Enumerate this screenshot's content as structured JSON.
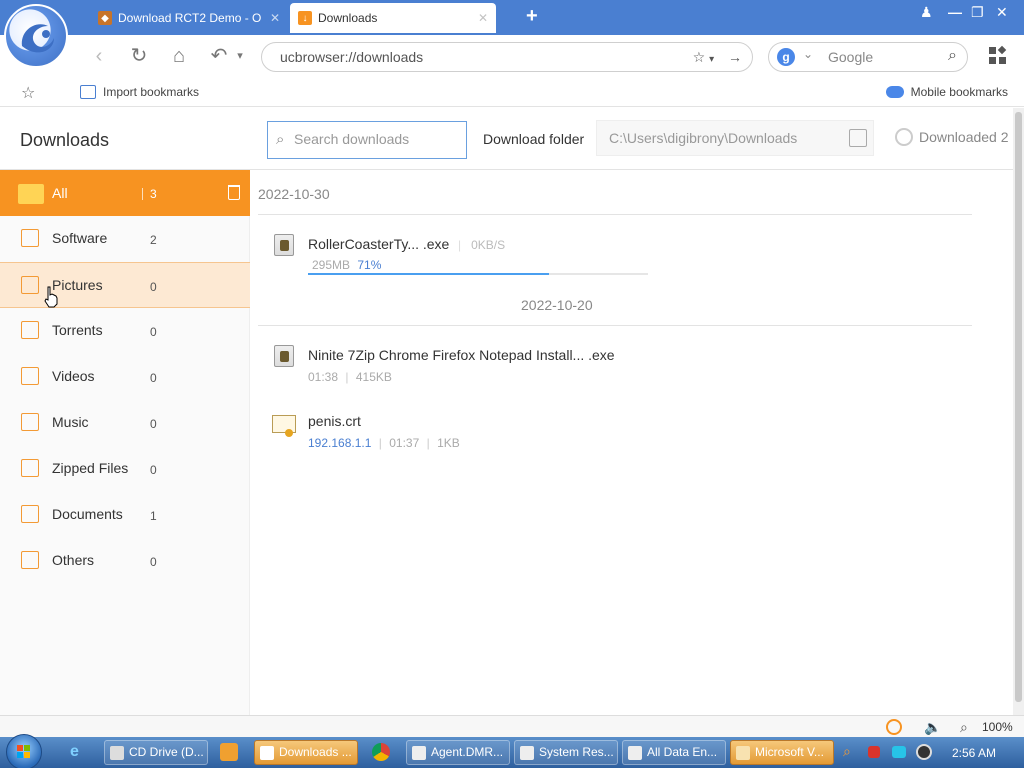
{
  "browser": {
    "tabs": [
      {
        "label": "Download RCT2 Demo - O",
        "active": false
      },
      {
        "label": "Downloads",
        "active": true
      }
    ],
    "address": "ucbrowser://downloads",
    "search_engine_placeholder": "Google"
  },
  "bookmarks": {
    "import_label": "Import bookmarks",
    "mobile_label": "Mobile bookmarks"
  },
  "downloads": {
    "title": "Downloads",
    "search_placeholder": "Search downloads",
    "folder_label": "Download folder",
    "folder_path": "C:\\Users\\digibrony\\Downloads",
    "downloaded_label": "Downloaded 2"
  },
  "categories": [
    {
      "label": "All",
      "count": "3",
      "selected": true
    },
    {
      "label": "Software",
      "count": "2"
    },
    {
      "label": "Pictures",
      "count": "0",
      "hover": true
    },
    {
      "label": "Torrents",
      "count": "0"
    },
    {
      "label": "Videos",
      "count": "0"
    },
    {
      "label": "Music",
      "count": "0"
    },
    {
      "label": "Zipped Files",
      "count": "0"
    },
    {
      "label": "Documents",
      "count": "1"
    },
    {
      "label": "Others",
      "count": "0"
    }
  ],
  "groups": [
    {
      "date": "2022-10-30",
      "items": [
        {
          "name": "RollerCoasterTy... .exe",
          "speed": "0KB/S",
          "size": "295MB",
          "progress": "71%",
          "progress_value": 0.71
        }
      ]
    },
    {
      "date": "2022-10-20",
      "items": [
        {
          "name": "Ninite 7Zip Chrome Firefox Notepad Install... .exe",
          "time": "01:38",
          "size": "415KB"
        },
        {
          "name": "penis.crt",
          "source": "192.168.1.1",
          "time": "01:37",
          "size": "1KB"
        }
      ]
    }
  ],
  "statusbar": {
    "zoom": "100%"
  },
  "taskbar": {
    "items": [
      {
        "label": "CD Drive (D..."
      },
      {
        "label": "Downloads ...",
        "active": true
      },
      {
        "label": "Agent.DMR..."
      },
      {
        "label": "System Res..."
      },
      {
        "label": "All Data En..."
      },
      {
        "label": "Microsoft V..."
      }
    ],
    "clock": "2:56 AM"
  },
  "colors": {
    "accent": "#f79321",
    "brand_blue": "#4a7fd1",
    "hover_row": "#fde9d3"
  }
}
